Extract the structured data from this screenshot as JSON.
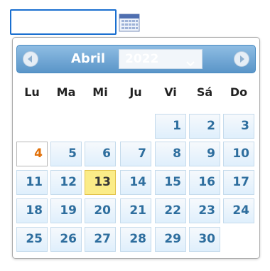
{
  "date_input": {
    "value": "",
    "placeholder": ""
  },
  "datepicker": {
    "month": "Abril",
    "year": "2022",
    "weekdays": [
      "Lu",
      "Ma",
      "Mi",
      "Ju",
      "Vi",
      "Sá",
      "Do"
    ],
    "weeks": [
      [
        "",
        "",
        "",
        "",
        "1",
        "2",
        "3"
      ],
      [
        "4",
        "5",
        "6",
        "7",
        "8",
        "9",
        "10"
      ],
      [
        "11",
        "12",
        "13",
        "14",
        "15",
        "16",
        "17"
      ],
      [
        "18",
        "19",
        "20",
        "21",
        "22",
        "23",
        "24"
      ],
      [
        "25",
        "26",
        "27",
        "28",
        "29",
        "30",
        ""
      ]
    ],
    "today_day": "4",
    "selected_day": "13"
  },
  "colors": {
    "header": "#6aa4d4",
    "day_text": "#2e6e9e",
    "today_text": "#e17009",
    "selected_bg": "#fbec88",
    "input_border": "#1a6fd0"
  },
  "icons": {
    "trigger": "calendar-icon",
    "prev": "circle-triangle-left-icon",
    "next": "circle-triangle-right-icon",
    "year_select": "chevron-down-icon"
  }
}
